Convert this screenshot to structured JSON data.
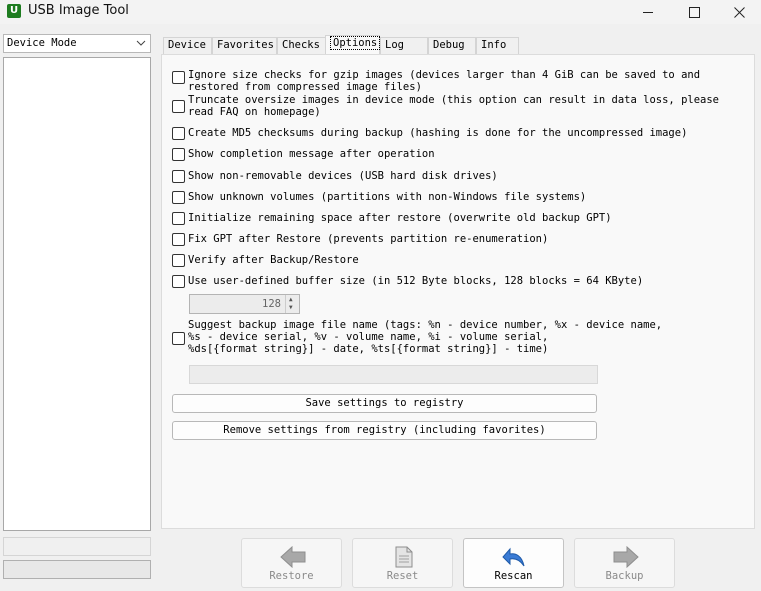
{
  "window": {
    "title": "USB Image Tool",
    "app_icon_glyph": "U"
  },
  "left": {
    "mode_select": "Device Mode"
  },
  "tabs": [
    "Device",
    "Favorites",
    "Checks",
    "Options",
    "Log",
    "Debug",
    "Info"
  ],
  "active_tab": "Options",
  "options": [
    {
      "lines": [
        "Ignore size checks for gzip images (devices larger than 4 GiB can be saved to and",
        "restored from compressed image files)"
      ],
      "checked": false
    },
    {
      "lines": [
        "Truncate oversize images in device mode (this option can result in data loss, please",
        "read FAQ on homepage)"
      ],
      "checked": false
    },
    {
      "lines": [
        "Create MD5 checksums during backup (hashing is done for the uncompressed image)"
      ],
      "checked": false
    },
    {
      "lines": [
        "Show completion message after operation"
      ],
      "checked": false
    },
    {
      "lines": [
        "Show non-removable devices (USB hard disk drives)"
      ],
      "checked": false
    },
    {
      "lines": [
        "Show unknown volumes (partitions with non-Windows file systems)"
      ],
      "checked": false
    },
    {
      "lines": [
        "Initialize remaining space after restore (overwrite old backup GPT)"
      ],
      "checked": false
    },
    {
      "lines": [
        "Fix GPT after Restore (prevents partition re-enumeration)"
      ],
      "checked": false
    },
    {
      "lines": [
        "Verify after Backup/Restore"
      ],
      "checked": false
    },
    {
      "lines": [
        "Use user-defined buffer size (in 512 Byte blocks, 128 blocks = 64 KByte)"
      ],
      "checked": false
    },
    {
      "lines": [
        "Suggest backup image file name (tags: %n - device number, %x - device name,",
        "%s - device serial, %v - volume name, %i - volume serial,",
        "%ds[{format string}] - date, %ts[{format string}] - time)"
      ],
      "checked": false
    }
  ],
  "buffer_size": "128",
  "filename_template": "",
  "buttons": {
    "save_registry": "Save settings to registry",
    "remove_registry": "Remove settings from registry (including favorites)"
  },
  "actions": [
    {
      "label": "Restore",
      "icon": "arrow-left-icon",
      "enabled": false
    },
    {
      "label": "Reset",
      "icon": "document-icon",
      "enabled": false
    },
    {
      "label": "Rescan",
      "icon": "rescan-arrow-icon",
      "enabled": true
    },
    {
      "label": "Backup",
      "icon": "arrow-right-icon",
      "enabled": false
    }
  ],
  "colors": {
    "app_icon": "#1e7c20",
    "rescan_icon": "#3a7bd5",
    "disabled_icon": "#9a9a9a"
  }
}
